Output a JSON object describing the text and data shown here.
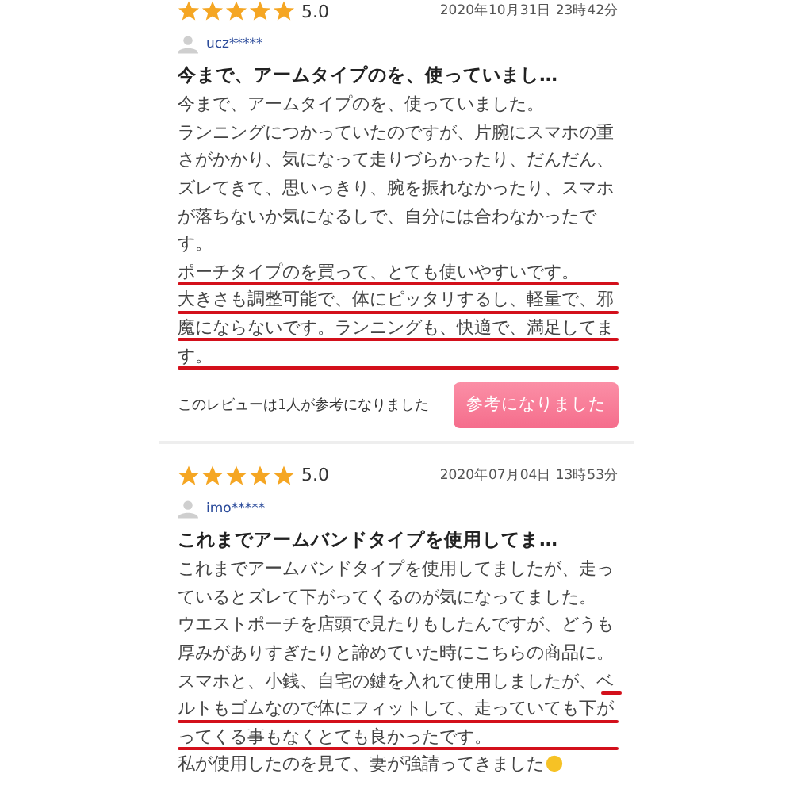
{
  "reviews": [
    {
      "stars": 5,
      "rating": "5.0",
      "date": "2020年10月31日 23時42分",
      "user": "ucz*****",
      "title": "今まで、アームタイプのを、使っていまし…",
      "lines": [
        {
          "text": "今まで、アームタイプのを、使っていました。",
          "underlined": false
        },
        {
          "text": "ランニングにつかっていたのですが、片腕にスマホの重",
          "underlined": false
        },
        {
          "text": "さがかかり、気になって走りづらかったり、だんだん、",
          "underlined": false
        },
        {
          "text": "ズレてきて、思いっきり、腕を振れなかったり、スマホ",
          "underlined": false
        },
        {
          "text": "が落ちないか気になるしで、自分には合わなかったで",
          "underlined": false
        },
        {
          "text": "す。",
          "underlined": false
        },
        {
          "text": "ポーチタイプのを買って、とても使いやすいです。",
          "underlined": true,
          "partial": false
        },
        {
          "text": "大きさも調整可能で、体にピッタリするし、軽量で、邪",
          "underlined": true,
          "partial": false
        },
        {
          "text": "魔にならないです。ランニングも、快適で、満足してま",
          "underlined": true,
          "partial": false
        },
        {
          "text": "す。",
          "underlined": true,
          "partial": false
        }
      ],
      "helpful_text": "このレビューは1人が参考になりました",
      "helpful_button": "参考になりました"
    },
    {
      "stars": 5,
      "rating": "5.0",
      "date": "2020年07月04日 13時53分",
      "user": "imo*****",
      "title": "これまでアームバンドタイプを使用してま…",
      "lines": [
        {
          "text": "これまでアームバンドタイプを使用してましたが、走っ",
          "underlined": false
        },
        {
          "text": "ているとズレて下がってくるのが気になってました。",
          "underlined": false
        },
        {
          "text": "ウエストポーチを店頭で見たりもしたんですが、どうも",
          "underlined": false
        },
        {
          "text": "厚みがありすぎたりと諦めていた時にこちらの商品に。",
          "underlined": false
        },
        {
          "text": "スマホと、小銭、自宅の鍵を入れて使用しましたが、ベ",
          "underlined": true,
          "partial": true
        },
        {
          "text": "ルトもゴムなので体にフィットして、走っていても下が",
          "underlined": true,
          "partial": false
        },
        {
          "text": "ってくる事もなくとても良かったです。",
          "underlined": true,
          "partial": false
        },
        {
          "text": "私が使用したのを見て、妻が強請ってきました",
          "underlined": false,
          "emoji": true
        }
      ]
    }
  ]
}
